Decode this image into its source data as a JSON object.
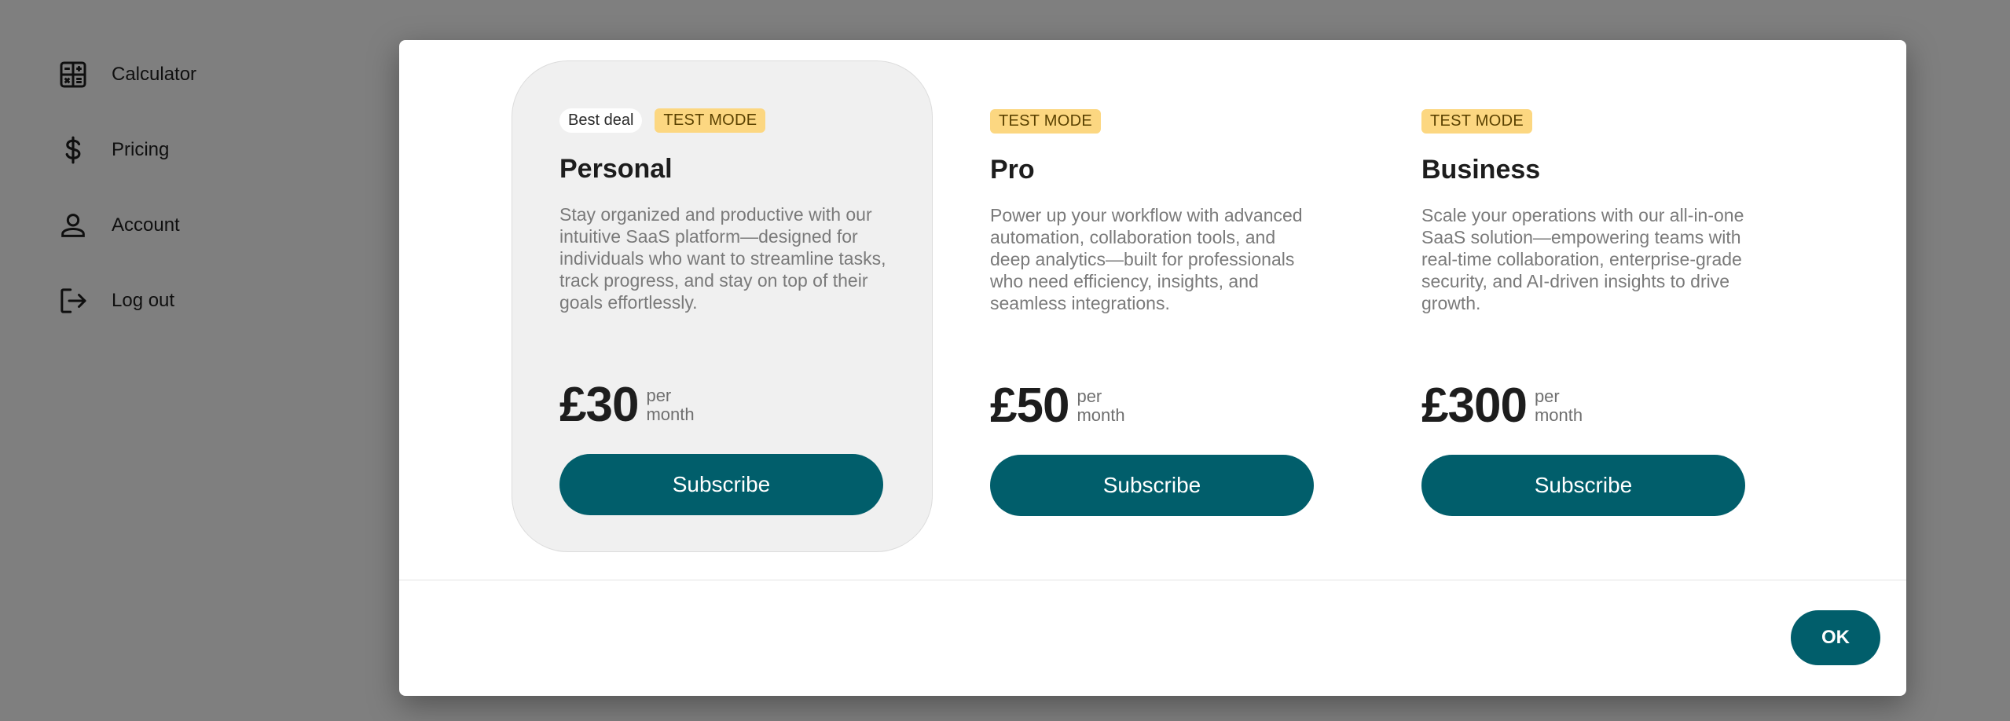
{
  "sidebar": {
    "items": [
      {
        "label": "Calculator",
        "icon": "calculator-icon"
      },
      {
        "label": "Pricing",
        "icon": "dollar-icon"
      },
      {
        "label": "Account",
        "icon": "user-icon"
      },
      {
        "label": "Log out",
        "icon": "logout-icon"
      }
    ]
  },
  "dialog": {
    "plans": [
      {
        "badge_deal": "Best deal",
        "badge_test": "TEST MODE",
        "name": "Personal",
        "description": "Stay organized and productive with our intuitive SaaS platform—designed for individuals who want to streamline tasks, track progress, and stay on top of their goals effortlessly.",
        "price": "£30",
        "per_line1": "per",
        "per_line2": "month",
        "button": "Subscribe"
      },
      {
        "badge_test": "TEST MODE",
        "name": "Pro",
        "description": "Power up your workflow with advanced automation, collaboration tools, and deep analytics—built for professionals who need efficiency, insights, and seamless integrations.",
        "price": "£50",
        "per_line1": "per",
        "per_line2": "month",
        "button": "Subscribe"
      },
      {
        "badge_test": "TEST MODE",
        "name": "Business",
        "description": "Scale your operations with our all-in-one SaaS solution—empowering teams with real-time collaboration, enterprise-grade security, and AI-driven insights to drive growth.",
        "price": "£300",
        "per_line1": "per",
        "per_line2": "month",
        "button": "Subscribe"
      }
    ],
    "ok_label": "OK"
  },
  "colors": {
    "accent": "#015e6b",
    "badge_test_bg": "#fcd781",
    "highlight_card_bg": "#f0f0f0"
  }
}
